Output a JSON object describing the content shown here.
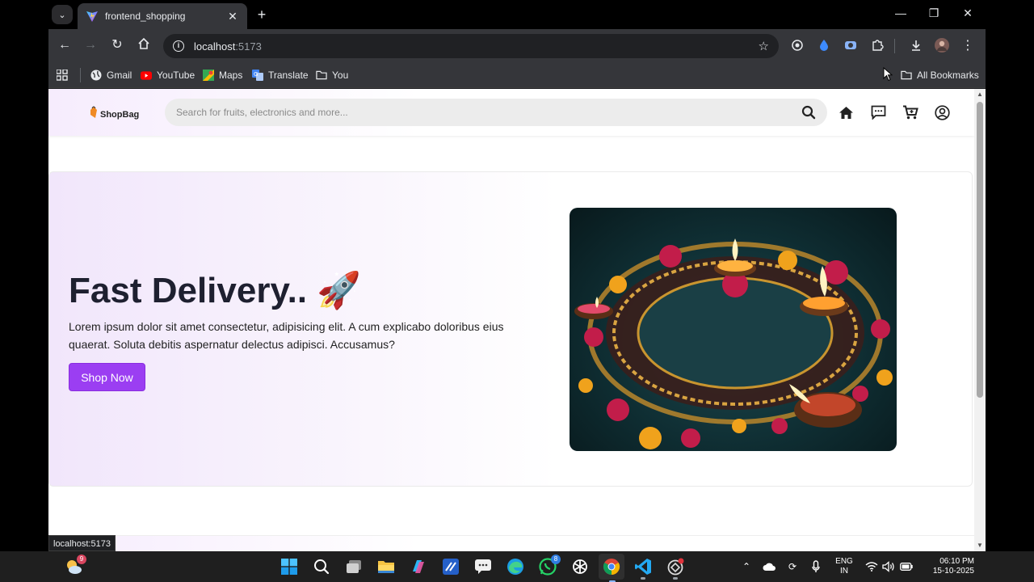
{
  "browser": {
    "tab_title": "frontend_shopping",
    "url_host": "localhost",
    "url_port": ":5173",
    "status_url": "localhost:5173"
  },
  "bookmarks": {
    "items": [
      "Gmail",
      "YouTube",
      "Maps",
      "Translate",
      "You"
    ],
    "all_bookmarks": "All Bookmarks"
  },
  "site": {
    "brand": "ShopBag",
    "search_placeholder": "Search for fruits, electronics and more...",
    "hero": {
      "title": "Fast Delivery..",
      "title_emoji": "🚀",
      "description": "Lorem ipsum dolor sit amet consectetur, adipisicing elit. A cum explicabo doloribus eius quaerat. Soluta debitis aspernatur delectus adipisci. Accusamus?",
      "cta": "Shop Now",
      "image_text": "Diwali"
    }
  },
  "taskbar": {
    "weather_badge": "9",
    "whatsapp_badge": "8",
    "lang_top": "ENG",
    "lang_bottom": "IN",
    "time": "06:10 PM",
    "date": "15-10-2025"
  },
  "colors": {
    "accent": "#9b3ef2",
    "hero_title": "#1e2030"
  }
}
